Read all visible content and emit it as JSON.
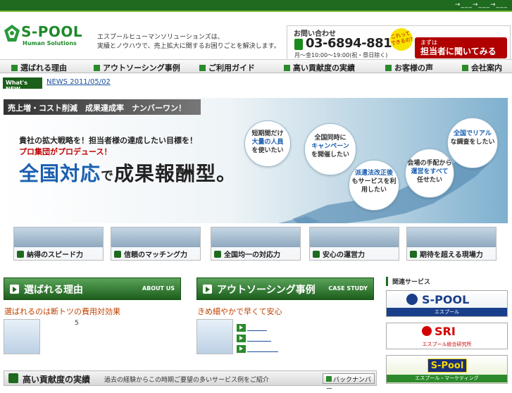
{
  "topbar": {
    "links_text": "→___→___→___"
  },
  "header": {
    "logo_name": "S-POOL",
    "logo_sub": "Human Solutions",
    "tagline_line1": "エスプールヒューマンソリューションズは、",
    "tagline_line2": "実績とノウハウで、売上拡大に関するお困りごとを解決します。",
    "contact_label": "お問い合わせ",
    "phone": "03-6894-8811",
    "hours": "月〜金10:00〜19:00(祝・祭日除く)",
    "bubble_text": "これって できるの?",
    "ask_small": "まずは",
    "ask_big": "担当者に聞いてみる"
  },
  "nav": [
    {
      "label": "選ばれる理由"
    },
    {
      "label": "アウトソーシング事例"
    },
    {
      "label": "ご利用ガイド"
    },
    {
      "label": "高い貢献度の実績"
    },
    {
      "label": "お客様の声"
    },
    {
      "label": "会社案内"
    }
  ],
  "news": {
    "badge": "What's NEW",
    "text": "NEWS 2011/05/02"
  },
  "hero": {
    "ribbon": "売上増・コスト削減　成果達成率　ナンバーワン！",
    "line1": "貴社の拡大戦略を！担当者様の達成したい目標を！",
    "line2": "プロ集団がプロデュース！",
    "main_a": "全国対応",
    "main_b": "で",
    "main_c": "成果報酬型。",
    "bubbles": [
      {
        "pre": "短期間だけ",
        "hl": "大量の人員",
        "post": "を使いたい"
      },
      {
        "pre": "全国同時に",
        "hl": "キャンペーン",
        "post": "を開催したい"
      },
      {
        "pre": "",
        "hl": "全国でリアル",
        "post": "な調査をしたい"
      },
      {
        "pre": "会場の手配から",
        "hl": "運営をすべて",
        "post": "任せたい"
      },
      {
        "pre": "",
        "hl": "派遣法改正後",
        "post": "もサービスを利用したい"
      }
    ]
  },
  "features": [
    {
      "label": "納得のスピード力"
    },
    {
      "label": "信頼のマッチング力"
    },
    {
      "label": "全国均一の対応力"
    },
    {
      "label": "安心の運営力"
    },
    {
      "label": "期待を超える現場力"
    }
  ],
  "sections": {
    "reason_title": "選ばれる理由",
    "reason_en": "ABOUT US",
    "reason_sub": "選ばれるのは断トツの費用対効果",
    "reason_num": "5",
    "case_title": "アウトソーシング事例",
    "case_en": "CASE STUDY",
    "case_sub": "きめ細やかで早くて安心"
  },
  "sidebar": {
    "heading": "関連サービス",
    "banner1": "S-POOL",
    "banner1_sub": "エスプール",
    "banner2": "SRI",
    "banner2_sub": "エスプール総合研究所",
    "banner3": "S-Pool",
    "banner3_sub": "エスプール・マーケティング"
  },
  "bottom": {
    "title": "高い貢献度の実績",
    "desc": "過去の経験からこの時期ご要望の多いサービス例をご紹介",
    "button": "バックナンバー"
  }
}
